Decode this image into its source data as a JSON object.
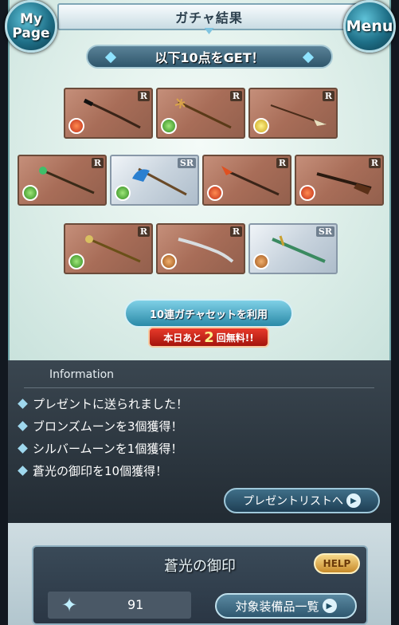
{
  "header": {
    "title": "ガチャ結果",
    "mypage_label": "My Page",
    "menu_label": "Menu"
  },
  "result": {
    "banner": "以下10点をGET！",
    "cards": [
      {
        "rarity": "R",
        "element": "fire",
        "weapon": "katana"
      },
      {
        "rarity": "R",
        "element": "wind",
        "weapon": "trident"
      },
      {
        "rarity": "R",
        "element": "light",
        "weapon": "spear"
      },
      {
        "rarity": "R",
        "element": "wind",
        "weapon": "staff"
      },
      {
        "rarity": "SR",
        "element": "wind",
        "weapon": "axe"
      },
      {
        "rarity": "R",
        "element": "fire",
        "weapon": "spear"
      },
      {
        "rarity": "R",
        "element": "fire",
        "weapon": "rifle"
      },
      {
        "rarity": "R",
        "element": "wind",
        "weapon": "staff"
      },
      {
        "rarity": "R",
        "element": "earth",
        "weapon": "sword"
      },
      {
        "rarity": "SR",
        "element": "earth",
        "weapon": "sword"
      }
    ]
  },
  "gacha": {
    "button_label": "10連ガチャセットを利用",
    "free_prefix": "本日あと",
    "free_count": "2",
    "free_suffix": "回無料!!"
  },
  "info": {
    "title": "Information",
    "items": [
      "プレゼントに送られました！",
      "ブロンズムーンを3個獲得！",
      "シルバームーンを1個獲得！",
      "蒼光の御印を10個獲得！"
    ],
    "present_button": "プレゼントリストへ"
  },
  "seal": {
    "title": "蒼光の御印",
    "help": "HELP",
    "count": "91",
    "equip_button": "対象装備品一覧"
  }
}
